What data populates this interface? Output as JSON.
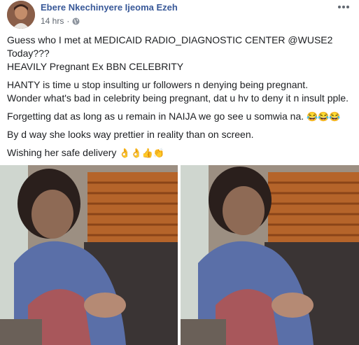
{
  "post": {
    "author": "Ebere Nkechinyere Ijeoma Ezeh",
    "time": "14 hrs",
    "privacy_icon": "globe-icon",
    "more_icon": "more-options-icon",
    "lines": [
      "Guess who I met at MEDICAID RADIO_DIAGNOSTIC CENTER @WUSE2",
      "Today???",
      "HEAVILY Pregnant Ex BBN CELEBRITY",
      "HANTY is time u stop insulting ur followers n denying being pregnant.",
      "Wonder what's bad in celebrity being pregnant, dat u hv to deny it n insult pple.",
      "Forgetting dat as long as u remain in NAIJA we go see u somwia na.",
      "By d way she looks way prettier in reality than on screen.",
      "Wishing her safe delivery"
    ],
    "emoji_laugh": "😂😂😂",
    "emoji_hands": "👌👌👍👏"
  },
  "photos": [
    {
      "name": "photo-left",
      "description_icon": "photo"
    },
    {
      "name": "photo-right",
      "description_icon": "photo"
    }
  ]
}
